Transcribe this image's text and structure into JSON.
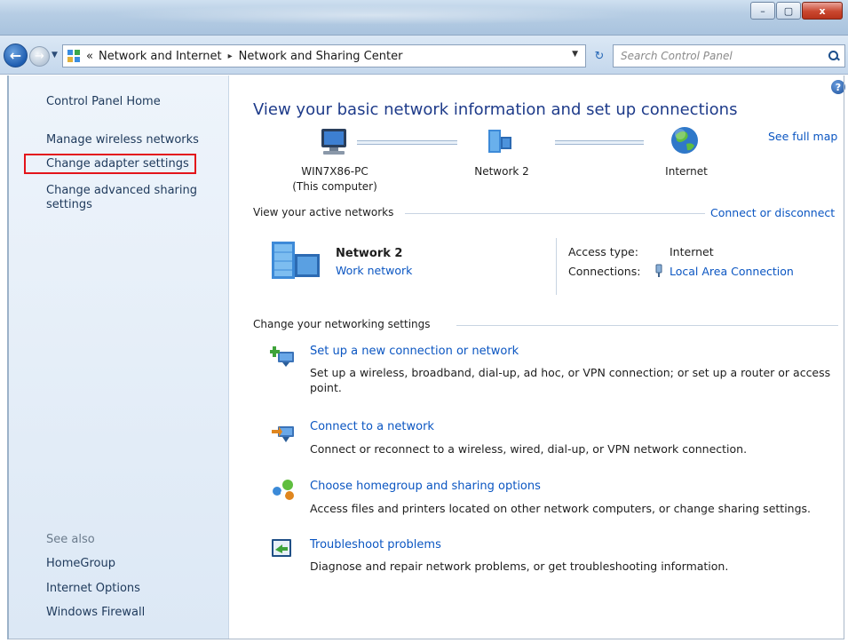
{
  "window": {
    "minimize_label": "–",
    "maximize_label": "▢",
    "close_label": "x"
  },
  "address": {
    "overflow": "«",
    "crumbs": [
      "Network and Internet",
      "Network and Sharing Center"
    ],
    "separator": "▸",
    "search_placeholder": "Search Control Panel"
  },
  "sidebar": {
    "home": "Control Panel Home",
    "items": [
      "Manage wireless networks",
      "Change adapter settings",
      "Change advanced sharing",
      "settings"
    ],
    "see_also_title": "See also",
    "see_also": [
      "HomeGroup",
      "Internet Options",
      "Windows Firewall"
    ]
  },
  "main": {
    "title": "View your basic network information and set up connections",
    "see_full_map": "See full map",
    "map": {
      "computer_name": "WIN7X86-PC",
      "computer_sub": "(This computer)",
      "network": "Network  2",
      "internet": "Internet"
    },
    "active_networks": {
      "heading": "View your active networks",
      "connect_link": "Connect or disconnect",
      "network_name": "Network  2",
      "network_type": "Work network",
      "access_type_label": "Access type:",
      "access_type_value": "Internet",
      "connections_label": "Connections:",
      "connections_value": "Local Area Connection"
    },
    "settings": {
      "heading": "Change your networking settings",
      "tasks": [
        {
          "title": "Set up a new connection or network",
          "desc": "Set up a wireless, broadband, dial-up, ad hoc, or VPN connection; or set up a router or access point."
        },
        {
          "title": "Connect to a network",
          "desc": "Connect or reconnect to a wireless, wired, dial-up, or VPN network connection."
        },
        {
          "title": "Choose homegroup and sharing options",
          "desc": "Access files and printers located on other network computers, or change sharing settings."
        },
        {
          "title": "Troubleshoot problems",
          "desc": "Diagnose and repair network problems, or get troubleshooting information."
        }
      ]
    }
  },
  "colors": {
    "link": "#0b56c2",
    "title": "#1e3b8a",
    "highlight": "#e3141a"
  }
}
